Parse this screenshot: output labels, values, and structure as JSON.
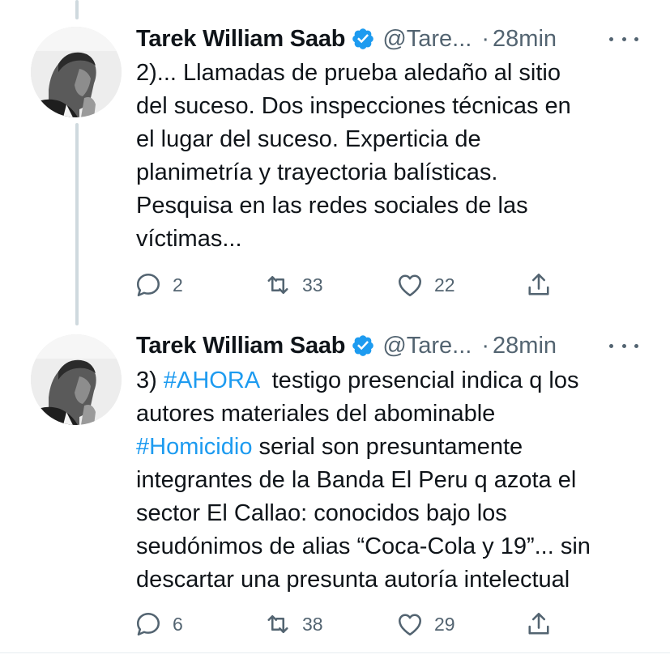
{
  "colors": {
    "link": "#1d9bf0",
    "secondary": "#536471",
    "verified": "#1d9bf0"
  },
  "tweets": [
    {
      "author_name": "Tarek William Saab",
      "handle": "@Tare...",
      "separator": "·",
      "time": "28min",
      "text_lines": [
        "2)... Llamadas de prueba aledaño al sitio",
        "del suceso. Dos inspecciones técnicas en",
        "el lugar del suceso. Experticia de",
        "planimetría y trayectoria balísticas.",
        "Pesquisa en las redes sociales de las",
        "víctimas..."
      ],
      "replies": "2",
      "retweets": "33",
      "likes": "22",
      "icons": [
        "avatar-photo",
        "verified-badge-icon",
        "more-icon",
        "reply-icon",
        "retweet-icon",
        "like-icon",
        "share-icon"
      ]
    },
    {
      "author_name": "Tarek William Saab",
      "handle": "@Tare...",
      "separator": "·",
      "time": "28min",
      "text_prefix": "3) ",
      "hashtag1": "#AHORA",
      "text_after_hashtag1": "  testigo presencial indica q los",
      "line2": "autores materiales del abominable",
      "hashtag2": "#Homicidio",
      "text_after_hashtag2": " serial son presuntamente",
      "line4": "integrantes de la Banda El Peru q azota el",
      "line5": "sector El Callao: conocidos bajo los",
      "line6": "seudónimos de alias “Coca-Cola y 19”... sin",
      "line7": "descartar una presunta autoría intelectual",
      "replies": "6",
      "retweets": "38",
      "likes": "29"
    }
  ]
}
